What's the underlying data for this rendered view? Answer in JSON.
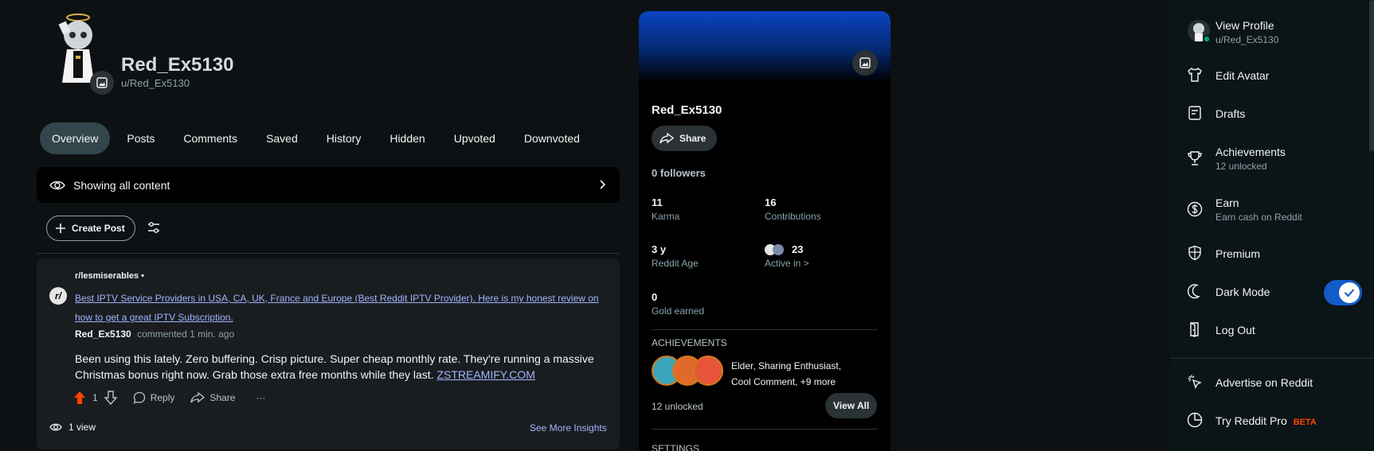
{
  "profile": {
    "display_name": "Red_Ex5130",
    "handle": "u/Red_Ex5130"
  },
  "tabs": [
    {
      "label": "Overview",
      "active": true
    },
    {
      "label": "Posts"
    },
    {
      "label": "Comments"
    },
    {
      "label": "Saved"
    },
    {
      "label": "History"
    },
    {
      "label": "Hidden"
    },
    {
      "label": "Upvoted"
    },
    {
      "label": "Downvoted"
    }
  ],
  "filter": {
    "label": "Showing all content"
  },
  "create_post_label": "Create Post",
  "comment_card": {
    "subreddit": "r/lesmiserables •",
    "post_title": "Best IPTV Service Providers in USA, CA, UK, France and Europe (Best Reddit IPTV Provider). Here is my honest review on how to get a great IPTV Subscription.",
    "author": "Red_Ex5130",
    "meta": "commented 1 min. ago",
    "body": "Been using this lately. Zero buffering. Crisp picture. Super cheap monthly rate. They're running a massive Christmas bonus right now. Grab those extra free months while they last.",
    "body_link": "ZSTREAMIFY.COM",
    "score": "1",
    "reply_label": "Reply",
    "share_label": "Share",
    "more_label": "···",
    "views": "1 view",
    "insights_label": "See More Insights"
  },
  "side_panel": {
    "name": "Red_Ex5130",
    "share_label": "Share",
    "followers": "0 followers",
    "karma_value": "11",
    "karma_label": "Karma",
    "contributions_value": "16",
    "contributions_label": "Contributions",
    "age_value": "3 y",
    "age_label": "Reddit Age",
    "active_value": "23",
    "active_label": "Active in >",
    "gold_value": "0",
    "gold_label": "Gold earned",
    "achievements_title": "ACHIEVEMENTS",
    "achievements_text": "Elder, Sharing Enthusiast, Cool Comment, +9 more",
    "achievements_count": "12 unlocked",
    "view_all_label": "View All",
    "settings_title": "SETTINGS"
  },
  "menu": {
    "view_profile": "View Profile",
    "view_profile_sub": "u/Red_Ex5130",
    "edit_avatar": "Edit Avatar",
    "drafts": "Drafts",
    "achievements": "Achievements",
    "achievements_sub": "12 unlocked",
    "earn": "Earn",
    "earn_sub": "Earn cash on Reddit",
    "premium": "Premium",
    "dark_mode": "Dark Mode",
    "dark_mode_on": true,
    "log_out": "Log Out",
    "advertise": "Advertise on Reddit",
    "try_pro": "Try Reddit Pro",
    "beta": "BETA"
  },
  "colors": {
    "background": "#0e1113",
    "accent_link": "#9fb4ff",
    "upvote": "#ff4500",
    "toggle_on": "#115bca"
  }
}
